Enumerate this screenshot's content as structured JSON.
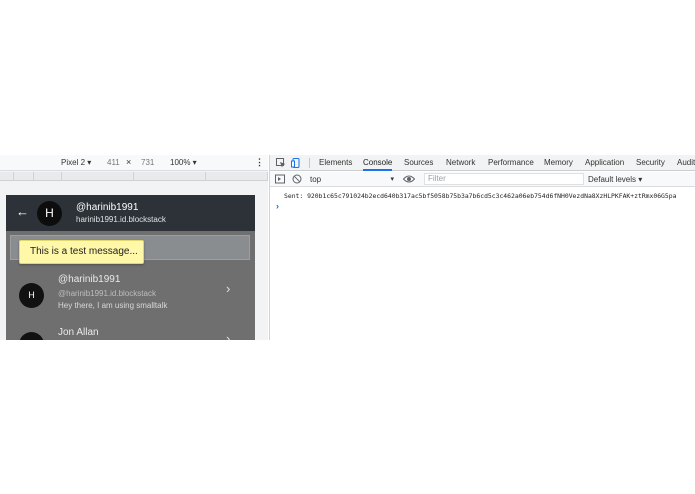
{
  "emulator": {
    "device": "Pixel 2 ▾",
    "width": "411",
    "times": "×",
    "height": "731",
    "zoom": "100% ▾",
    "more": "⋮"
  },
  "app": {
    "back": "←",
    "avatar_letter": "H",
    "username": "@harinib1991",
    "userid": "harinib1991.id.blockstack",
    "toast": "This is a test message...",
    "chats": [
      {
        "avatar": "H",
        "name": "@harinib1991",
        "id": "@harinib1991.id.blockstack",
        "message": "Hey there, I am using smalltalk",
        "chevron": "›"
      },
      {
        "avatar": "H",
        "name": "Jon Allan",
        "id": "",
        "message": "",
        "chevron": "›"
      }
    ]
  },
  "devtools": {
    "tabs": [
      "Elements",
      "Console",
      "Sources",
      "Network",
      "Performance",
      "Memory",
      "Application",
      "Security",
      "Audits"
    ],
    "active_tab": "Console",
    "context": "top",
    "context_arrow": "▾",
    "filter_placeholder": "Filter",
    "levels": "Default levels ▾",
    "log": "Sent: 920b1c65c791024b2ecd640b317ac5bf5058b75b3a7b6cd5c3c462a06eb754d6fNH0VezdNa8XzHLPKFAK+ztRmx06G5pa",
    "prompt": "›"
  },
  "colors": {
    "accent": "#1a73e8",
    "app_header": "#2c3237",
    "toast_bg": "#fff8a8"
  }
}
